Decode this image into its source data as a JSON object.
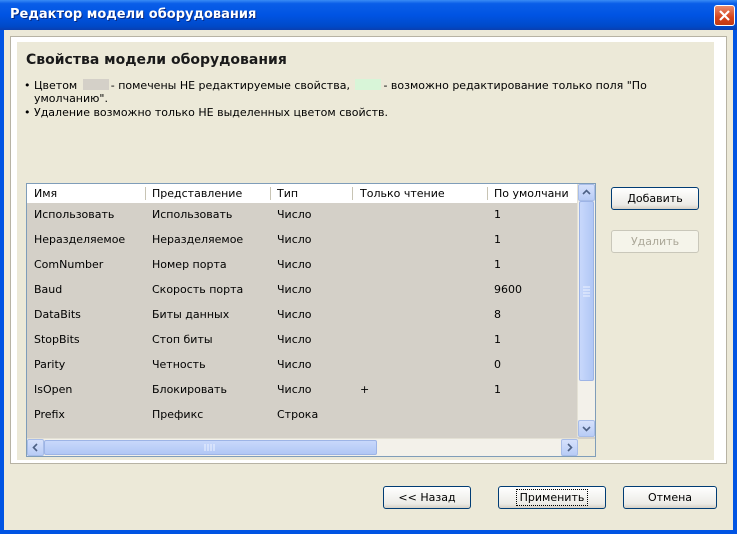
{
  "window": {
    "title": "Редактор модели оборудования"
  },
  "colors": {
    "readonly_swatch": "#d4d0c8",
    "default_only_swatch": "#d8f5d8"
  },
  "panel": {
    "heading": "Свойства модели оборудования",
    "note1_a": "Цветом",
    "note1_b": "- помечены НЕ редактируемые свойства,",
    "note1_c": "- возможно редактирование только поля \"По",
    "note1_d": "умолчанию\".",
    "note2": "Удаление возможно только НЕ выделенных цветом свойств.",
    "bullet": "•"
  },
  "grid": {
    "columns": [
      "Имя",
      "Представление",
      "Тип",
      "Только чтение",
      "По умолчани"
    ],
    "rows": [
      [
        "Использовать",
        "Использовать",
        "Число",
        "",
        "1"
      ],
      [
        "Неразделяемое",
        "Неразделяемое",
        "Число",
        "",
        "1"
      ],
      [
        "ComNumber",
        "Номер порта",
        "Число",
        "",
        "1"
      ],
      [
        "Baud",
        "Скорость порта",
        "Число",
        "",
        "9600"
      ],
      [
        "DataBits",
        "Биты данных",
        "Число",
        "",
        "8"
      ],
      [
        "StopBits",
        "Стоп биты",
        "Число",
        "",
        "1"
      ],
      [
        "Parity",
        "Четность",
        "Число",
        "",
        "0"
      ],
      [
        "IsOpen",
        "Блокировать",
        "Число",
        "+",
        "1"
      ],
      [
        "Prefix",
        "Префикс",
        "Строка",
        "",
        ""
      ]
    ]
  },
  "buttons": {
    "add": "Добавить",
    "delete": "Удалить",
    "back": "<< Назад",
    "apply": "Применить",
    "cancel": "Отмена"
  }
}
